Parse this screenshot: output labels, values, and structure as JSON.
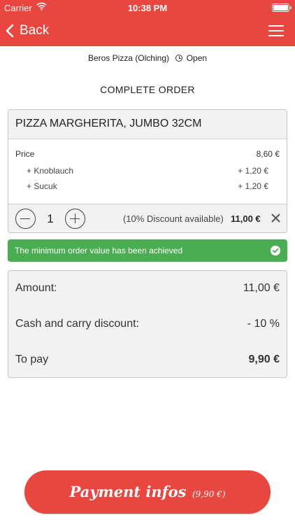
{
  "status_bar": {
    "carrier": "Carrier",
    "time": "10:38 PM",
    "icons": [
      "wifi-icon",
      "battery-icon"
    ]
  },
  "nav": {
    "back_label": "Back",
    "icons": [
      "chevron-left-icon",
      "hamburger-menu-icon"
    ]
  },
  "restaurant": {
    "name": "Beros Pizza (Olching)",
    "status": "Open",
    "icon": "clock-icon"
  },
  "page_title": "COMPLETE ORDER",
  "item": {
    "name": "PIZZA MARGHERITA, JUMBO 32CM",
    "price_label": "Price",
    "price_value": "8,60 €",
    "extras": [
      {
        "label": "+ Knoblauch",
        "value": "+ 1,20 €"
      },
      {
        "label": "+ Sucuk",
        "value": "+ 1,20 €"
      }
    ],
    "quantity": "1",
    "discount_note": "(10% Discount available)",
    "line_total": "11,00 €",
    "icons": [
      "minus-icon",
      "plus-icon",
      "close-icon"
    ]
  },
  "banner": {
    "message": "The minimum order value has been achieved",
    "icon": "check-circle-icon",
    "color": "#4aad52"
  },
  "summary": {
    "rows": [
      {
        "label": "Amount:",
        "value": "11,00 €"
      },
      {
        "label": "Cash and carry discount:",
        "value": "- 10 %"
      },
      {
        "label": "To pay",
        "value": "9,90 €"
      }
    ]
  },
  "pay_button": {
    "label": "Payment infos",
    "amount": "(9,90 €)"
  },
  "colors": {
    "accent": "#e8463f",
    "success": "#4aad52",
    "panel": "#f2f2f2"
  }
}
